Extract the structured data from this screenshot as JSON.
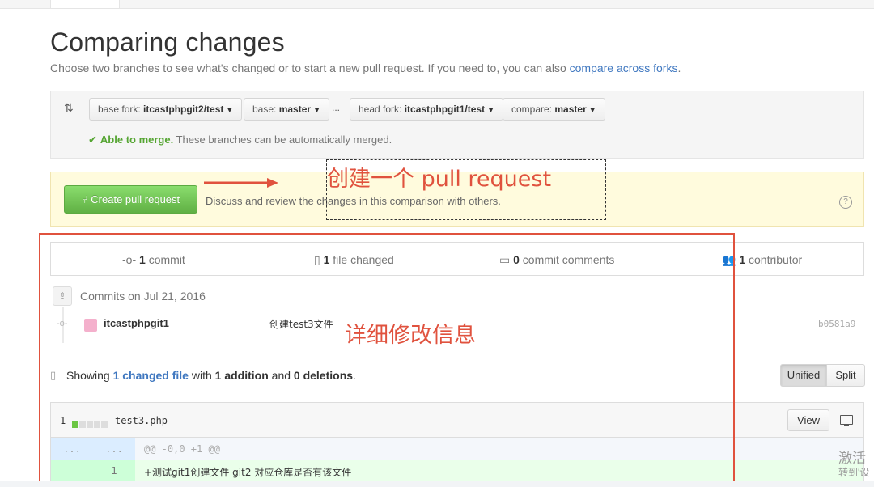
{
  "header": {
    "title": "Comparing changes",
    "subtitle_prefix": "Choose two branches to see what's changed or to start a new pull request. If you need to, you can also ",
    "subtitle_link": "compare across forks",
    "subtitle_suffix": "."
  },
  "compare": {
    "icon": "compare-arrows-icon",
    "base_fork_label": "base fork:",
    "base_fork_value": "itcastphpgit2/test",
    "base_label": "base:",
    "base_value": "master",
    "dots": "...",
    "head_fork_label": "head fork:",
    "head_fork_value": "itcastphpgit1/test",
    "compare_label": "compare:",
    "compare_value": "master",
    "merge_check": "✔",
    "merge_status": "Able to merge.",
    "merge_detail": " These branches can be automatically merged."
  },
  "pull_request": {
    "button_label": "Create pull request",
    "description": "Discuss and review the changes in this comparison with others.",
    "help": "?"
  },
  "annotations": {
    "create_note": "创建一个   pull  request",
    "detail_note": "详细修改信息"
  },
  "summary": {
    "commits_count": "1",
    "commits_label": " commit",
    "files_count": "1",
    "files_label": " file changed",
    "comments_count": "0",
    "comments_label": " commit comments",
    "contributors_count": "1",
    "contributors_label": " contributor"
  },
  "commits": {
    "date_heading": "Commits on Jul 21, 2016",
    "items": [
      {
        "author": "itcastphpgit1",
        "message": "创建test3文件",
        "sha": "b0581a9"
      }
    ]
  },
  "diff_summary": {
    "prefix": "Showing ",
    "link": "1 changed file",
    "middle": " with ",
    "additions": "1 addition",
    "and": " and ",
    "deletions": "0 deletions",
    "suffix": ".",
    "unified_label": "Unified",
    "split_label": "Split"
  },
  "file": {
    "count": "1",
    "name": "test3.php",
    "view_label": "View",
    "hunk_left": "...",
    "hunk_right": "...",
    "hunk_header": "@@ -0,0 +1 @@",
    "added_line_number": "1",
    "added_line": "+测试git1创建文件      git2    对应仓库是否有该文件"
  },
  "watermark": {
    "line1": "激活",
    "line2": "转到'设"
  },
  "colors": {
    "accent_link": "#4078c0",
    "merge_green": "#55a532",
    "button_green": "#60b044",
    "annotation_red": "#e0523e"
  }
}
